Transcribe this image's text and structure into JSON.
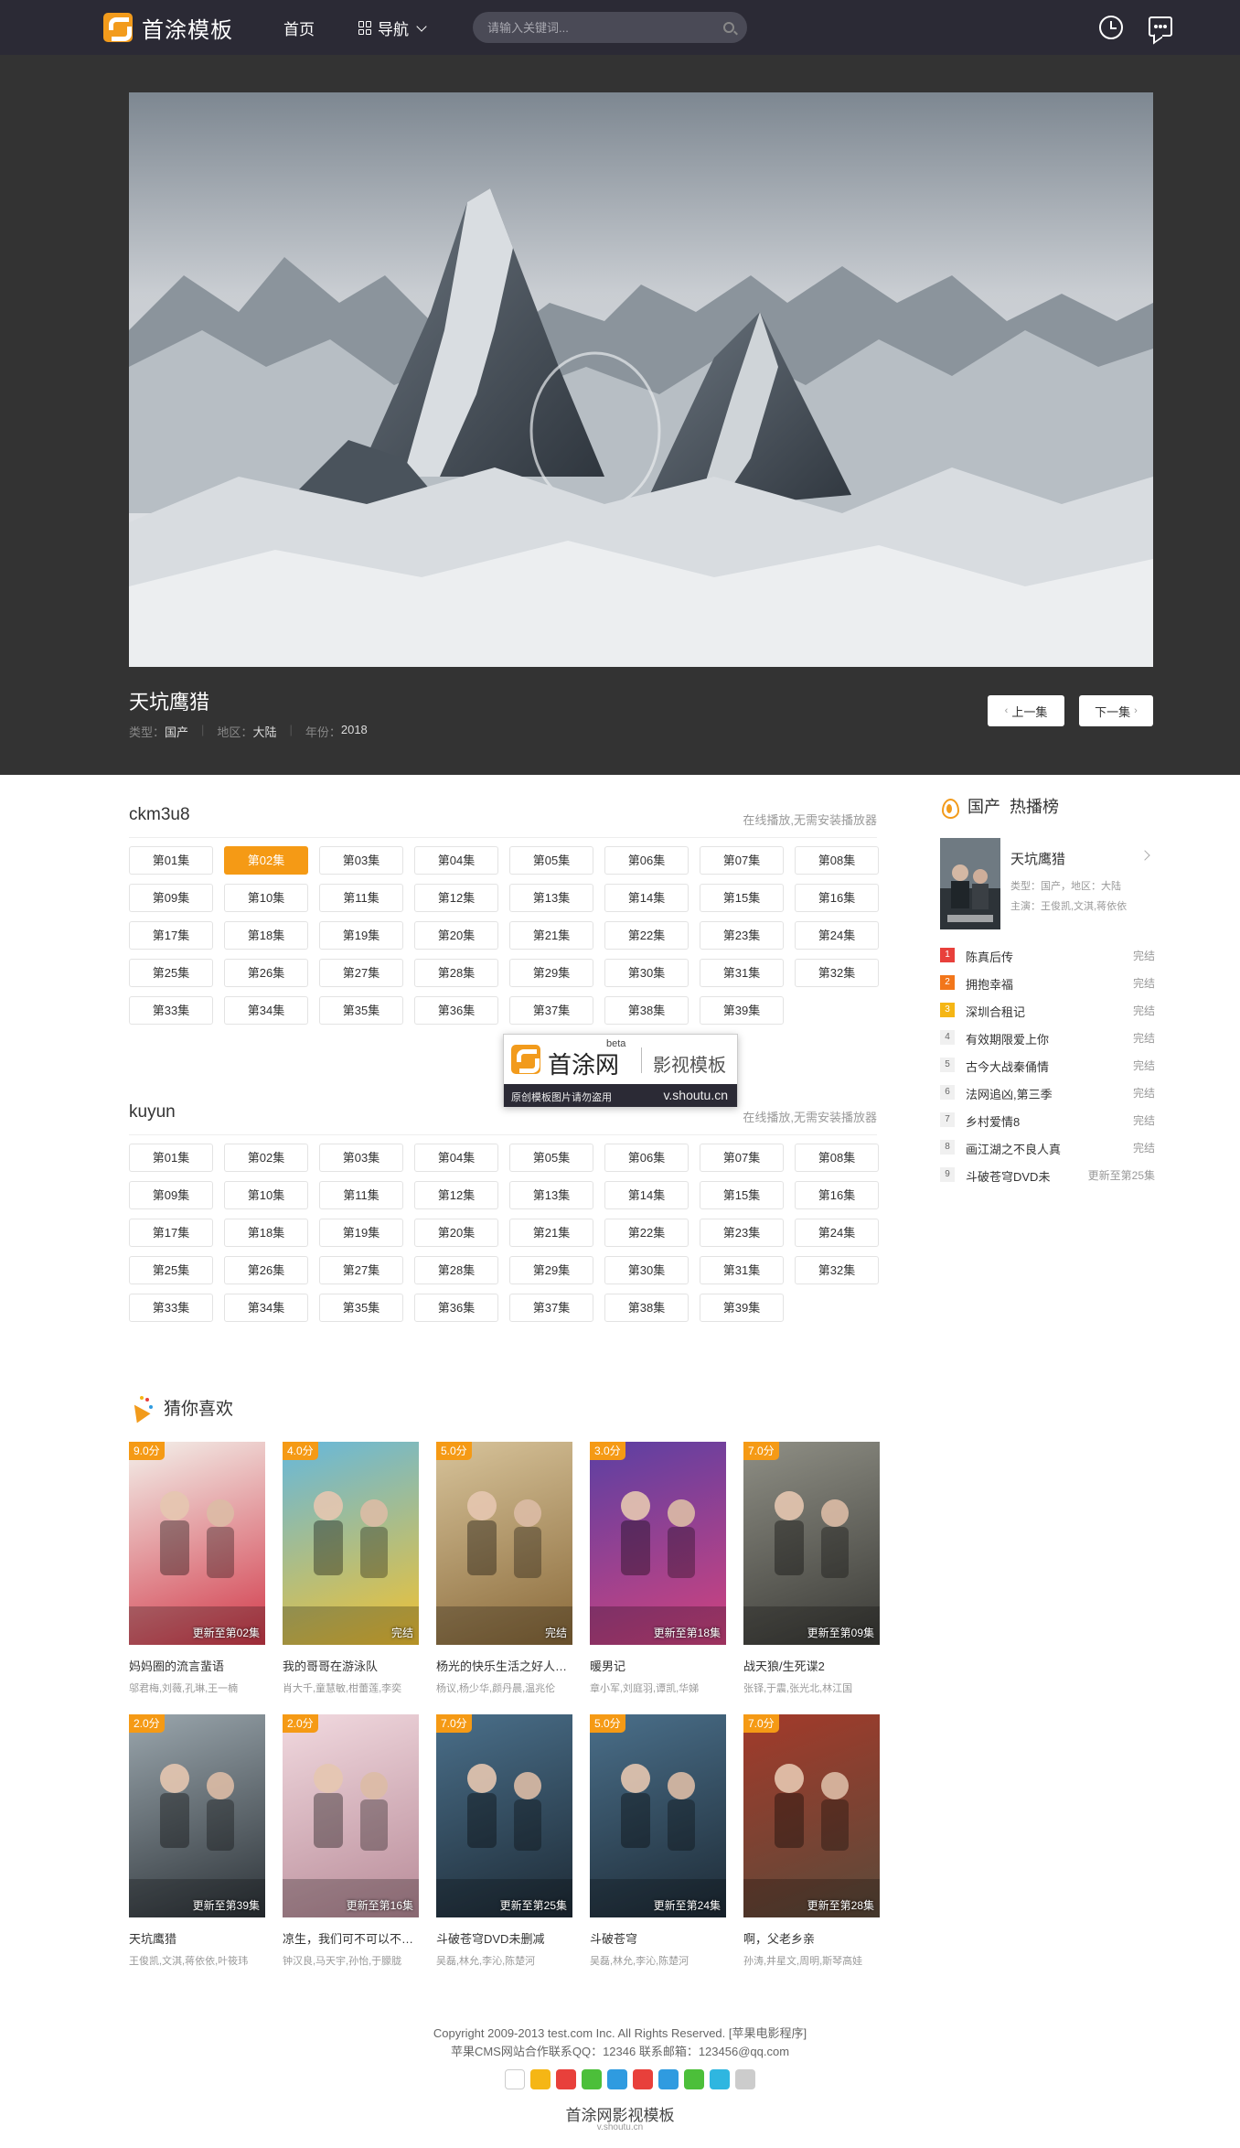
{
  "header": {
    "logo_text": "首涂模板",
    "nav_home": "首页",
    "nav_guide": "导航",
    "search_placeholder": "请输入关键词..."
  },
  "video": {
    "title": "天坑鹰猎",
    "type_label": "类型：",
    "type_value": "国产",
    "region_label": "地区：",
    "region_value": "大陆",
    "year_label": "年份：",
    "year_value": "2018",
    "prev_label": "上一集",
    "next_label": "下一集"
  },
  "sources": [
    {
      "name": "ckm3u8",
      "note": "在线播放,无需安装播放器",
      "active": 1
    },
    {
      "name": "kuyun",
      "note": "在线播放,无需安装播放器",
      "active": -1
    }
  ],
  "episodes": [
    "第01集",
    "第02集",
    "第03集",
    "第04集",
    "第05集",
    "第06集",
    "第07集",
    "第08集",
    "第09集",
    "第10集",
    "第11集",
    "第12集",
    "第13集",
    "第14集",
    "第15集",
    "第16集",
    "第17集",
    "第18集",
    "第19集",
    "第20集",
    "第21集",
    "第22集",
    "第23集",
    "第24集",
    "第25集",
    "第26集",
    "第27集",
    "第28集",
    "第29集",
    "第30集",
    "第31集",
    "第32集",
    "第33集",
    "第34集",
    "第35集",
    "第36集",
    "第37集",
    "第38集",
    "第39集"
  ],
  "watermark": {
    "name": "首涂网",
    "beta": "beta",
    "sub": "影视模板",
    "note": "原创模板图片请勿盗用",
    "url": "v.shoutu.cn"
  },
  "guess": {
    "title": "猜你喜欢",
    "items": [
      {
        "score": "9.0分",
        "update": "更新至第02集",
        "title": "妈妈圈的流言蜚语",
        "actors": "邬君梅,刘薇,孔琳,王一楠",
        "colors": [
          "#f3f0ea",
          "#d23a4a"
        ]
      },
      {
        "score": "4.0分",
        "update": "完结",
        "title": "我的哥哥在游泳队",
        "actors": "肖大千,童慧敏,柑蕾莲,李奕",
        "colors": [
          "#66b8dc",
          "#f2c231"
        ]
      },
      {
        "score": "5.0分",
        "update": "完结",
        "title": "杨光的快乐生活之好人杨光",
        "actors": "杨议,杨少华,颜丹晨,温兆伦",
        "colors": [
          "#d7c39a",
          "#8a6a3a"
        ]
      },
      {
        "score": "3.0分",
        "update": "更新至第18集",
        "title": "暖男记",
        "actors": "章小军,刘庭羽,谭凯,华娣",
        "colors": [
          "#5b3fa3",
          "#d2437e"
        ]
      },
      {
        "score": "7.0分",
        "update": "更新至第09集",
        "title": "战天狼/生死谍2",
        "actors": "张铎,于震,张光北,林江国",
        "colors": [
          "#8f8f85",
          "#3a3a36"
        ]
      },
      {
        "score": "2.0分",
        "update": "更新至第39集",
        "title": "天坑鹰猎",
        "actors": "王俊凯,文淇,蒋依依,叶筱玮",
        "colors": [
          "#9aa6ad",
          "#2d3338"
        ]
      },
      {
        "score": "2.0分",
        "update": "更新至第16集",
        "title": "凉生，我们可不可以不忧伤",
        "actors": "钟汉良,马天宇,孙怡,于朦胧",
        "colors": [
          "#f1d9df",
          "#b88b98"
        ]
      },
      {
        "score": "7.0分",
        "update": "更新至第25集",
        "title": "斗破苍穹DVD未删减",
        "actors": "吴磊,林允,李沁,陈楚河",
        "colors": [
          "#4a6f8a",
          "#1e2b36"
        ]
      },
      {
        "score": "5.0分",
        "update": "更新至第24集",
        "title": "斗破苍穹",
        "actors": "吴磊,林允,李沁,陈楚河",
        "colors": [
          "#4a6f8a",
          "#1e2b36"
        ]
      },
      {
        "score": "7.0分",
        "update": "更新至第28集",
        "title": "啊，父老乡亲",
        "actors": "孙涛,井星文,周明,斯琴高娃",
        "colors": [
          "#a33a2a",
          "#5a4a3a"
        ]
      }
    ]
  },
  "sidebar": {
    "title": "国产  热播榜",
    "featured": {
      "title": "天坑鹰猎",
      "meta1": "类型：国产，地区：大陆",
      "meta2": "主演：王俊凯,文淇,蒋依依"
    },
    "ranks": [
      {
        "n": "1",
        "title": "陈真后传",
        "status": "完结",
        "color": "#e8403b"
      },
      {
        "n": "2",
        "title": "拥抱幸福",
        "status": "完结",
        "color": "#f2761a"
      },
      {
        "n": "3",
        "title": "深圳合租记",
        "status": "完结",
        "color": "#f5b615"
      },
      {
        "n": "4",
        "title": "有效期限爱上你",
        "status": "完结",
        "color": ""
      },
      {
        "n": "5",
        "title": "古今大战秦俑情",
        "status": "完结",
        "color": ""
      },
      {
        "n": "6",
        "title": "法网追凶,第三季",
        "status": "完结",
        "color": ""
      },
      {
        "n": "7",
        "title": "乡村爱情8",
        "status": "完结",
        "color": ""
      },
      {
        "n": "8",
        "title": "画江湖之不良人真",
        "status": "完结",
        "color": ""
      },
      {
        "n": "9",
        "title": "斗破苍穹DVD未",
        "status": "更新至第25集",
        "color": ""
      }
    ]
  },
  "footer": {
    "copyright": "Copyright 2009-2013 test.com Inc. All Rights Reserved. [苹果电影程序]",
    "contact": "苹果CMS网站合作联系QQ：12346 联系邮箱：123456@qq.com",
    "brand": "首涂网影视模板",
    "brand_url": "v.shoutu.cn"
  }
}
